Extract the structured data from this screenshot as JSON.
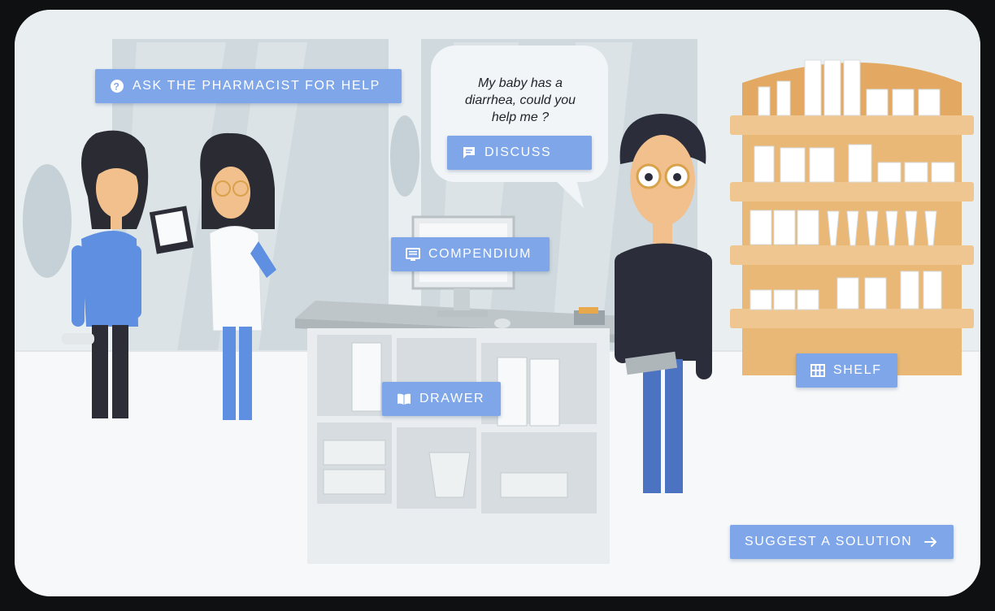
{
  "speech_bubble": {
    "text_line1": "My baby has a",
    "text_line2": "diarrhea, could you",
    "text_line3": "help me ?"
  },
  "buttons": {
    "ask_pharmacist": {
      "label": "ASK THE PHARMACIST FOR HELP",
      "icon": "help-circle-icon"
    },
    "discuss": {
      "label": "DISCUSS",
      "icon": "chat-icon"
    },
    "compendium": {
      "label": "COMPENDIUM",
      "icon": "monitor-list-icon"
    },
    "drawer": {
      "label": "DRAWER",
      "icon": "open-book-icon"
    },
    "shelf": {
      "label": "SHELF",
      "icon": "grid-icon"
    },
    "suggest_solution": {
      "label": "SUGGEST A SOLUTION",
      "icon": "arrow-right-icon"
    }
  },
  "colors": {
    "button": "#7ea6e8",
    "background": "#f3f6f8",
    "frame": "#0f1012",
    "shelf_wood": "#e9b877"
  }
}
